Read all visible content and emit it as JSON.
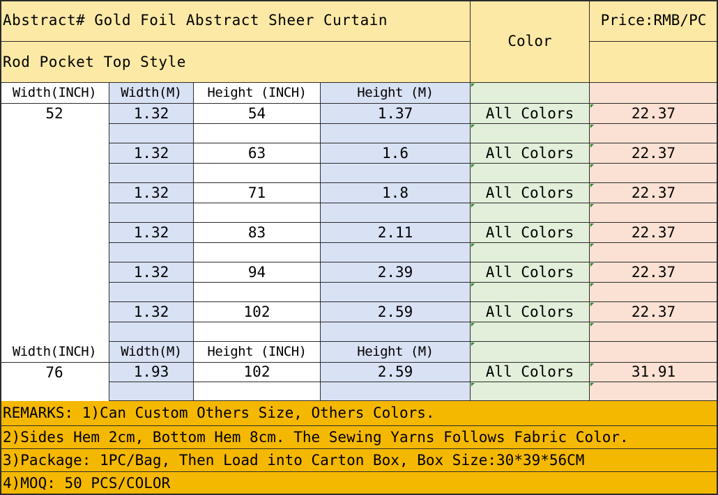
{
  "colors": {
    "title_bg": "#fde9a6",
    "blue_col": "#d9e1f4",
    "green_col": "#e2efda",
    "peach_col": "#fbe1d3",
    "remarks_bg": "#f5b800",
    "white": "#ffffff"
  },
  "title": {
    "line1": "Abstract# Gold Foil Abstract Sheer Curtain",
    "line2": "Rod Pocket Top Style",
    "color_header": "Color",
    "price_header": "Price:RMB/PC"
  },
  "columns": {
    "width_inch": "Width(INCH)",
    "width_m": "Width(M)",
    "height_inch": "Height (INCH)",
    "height_m": "Height (M)"
  },
  "section1": {
    "width_inch": "52",
    "rows": [
      {
        "width_m": "1.32",
        "height_inch": "54",
        "height_m": "1.37",
        "color": "All Colors",
        "price": "22.37"
      },
      {
        "width_m": "1.32",
        "height_inch": "63",
        "height_m": "1.6",
        "color": "All Colors",
        "price": "22.37"
      },
      {
        "width_m": "1.32",
        "height_inch": "71",
        "height_m": "1.8",
        "color": "All Colors",
        "price": "22.37"
      },
      {
        "width_m": "1.32",
        "height_inch": "83",
        "height_m": "2.11",
        "color": "All Colors",
        "price": "22.37"
      },
      {
        "width_m": "1.32",
        "height_inch": "94",
        "height_m": "2.39",
        "color": "All Colors",
        "price": "22.37"
      },
      {
        "width_m": "1.32",
        "height_inch": "102",
        "height_m": "2.59",
        "color": "All Colors",
        "price": "22.37"
      }
    ]
  },
  "section2": {
    "width_inch": "76",
    "rows": [
      {
        "width_m": "1.93",
        "height_inch": "102",
        "height_m": "2.59",
        "color": "All Colors",
        "price": "31.91"
      }
    ]
  },
  "remarks": [
    "REMARKS:  1)Can Custom Others Size, Others Colors.",
    "2)Sides Hem 2cm, Bottom Hem 8cm. The Sewing Yarns Follows Fabric Color.",
    "3)Package: 1PC/Bag, Then Load into Carton Box, Box Size:30*39*56CM",
    "4)MOQ: 50 PCS/COLOR"
  ]
}
